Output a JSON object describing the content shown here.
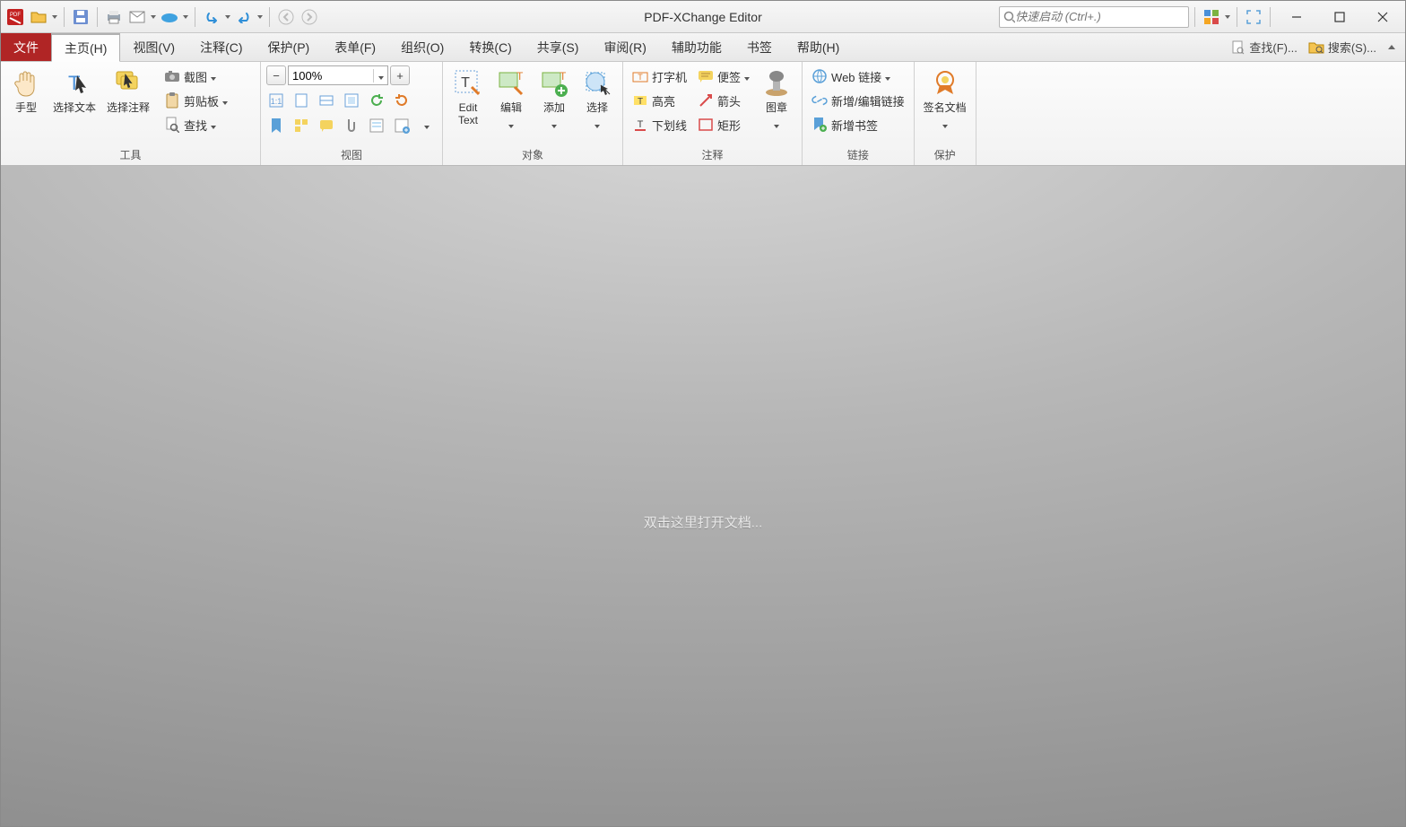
{
  "app": {
    "title": "PDF-XChange Editor"
  },
  "quick_launch": {
    "placeholder": "快速启动 (Ctrl+.)"
  },
  "menu": {
    "file": "文件",
    "tabs": [
      {
        "label": "主页(H)",
        "active": true
      },
      {
        "label": "视图(V)"
      },
      {
        "label": "注释(C)"
      },
      {
        "label": "保护(P)"
      },
      {
        "label": "表单(F)"
      },
      {
        "label": "组织(O)"
      },
      {
        "label": "转换(C)"
      },
      {
        "label": "共享(S)"
      },
      {
        "label": "审阅(R)"
      },
      {
        "label": "辅助功能"
      },
      {
        "label": "书签"
      },
      {
        "label": "帮助(H)"
      }
    ],
    "right": {
      "find": "查找(F)...",
      "search": "搜索(S)..."
    }
  },
  "ribbon": {
    "groups": {
      "tools": {
        "title": "工具",
        "hand": "手型",
        "select_text": "选择文本",
        "select_annot": "选择注释",
        "screenshot": "截图",
        "clipboard": "剪贴板",
        "find": "查找"
      },
      "view": {
        "title": "视图",
        "zoom": "100%"
      },
      "objects": {
        "title": "对象",
        "edit_text": "Edit\nText",
        "edit": "编辑",
        "add": "添加",
        "select": "选择"
      },
      "annot": {
        "title": "注释",
        "typewriter": "打字机",
        "note": "便签",
        "highlight": "高亮",
        "arrow": "箭头",
        "underline": "下划线",
        "rect": "矩形",
        "stamp": "图章"
      },
      "links": {
        "title": "链接",
        "web": "Web 链接",
        "edit_link": "新增/编辑链接",
        "bookmark": "新增书签"
      },
      "protect": {
        "title": "保护",
        "sign": "签名文档"
      }
    }
  },
  "canvas": {
    "empty_msg": "双击这里打开文档..."
  }
}
